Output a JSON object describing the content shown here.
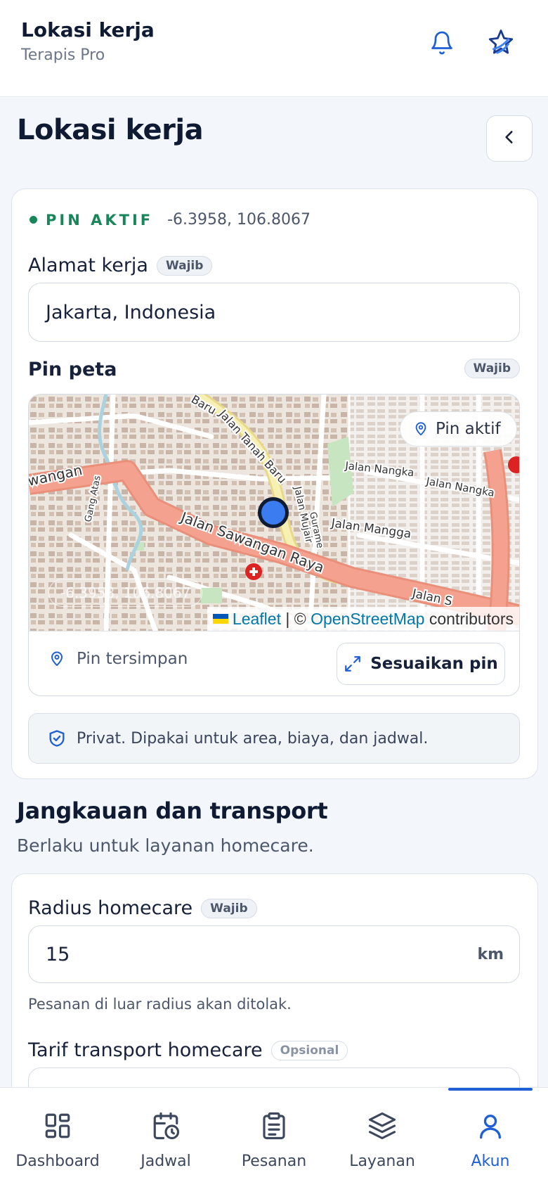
{
  "header": {
    "title": "Lokasi kerja",
    "subtitle": "Terapis Pro",
    "icons": {
      "notifications": "bell-icon",
      "brand": "brand-logo-icon"
    }
  },
  "page": {
    "title": "Lokasi kerja",
    "back_icon": "chevron-left-icon"
  },
  "location_card": {
    "status_label": "PIN AKTIF",
    "coords": "-6.3958, 106.8067",
    "address": {
      "label": "Alamat kerja",
      "badge": "Wajib",
      "value": "Jakarta, Indonesia"
    },
    "pin": {
      "label": "Pin peta",
      "badge": "Wajib",
      "map": {
        "chip": "Pin aktif",
        "coords_overlay": "-6.3958, 106.8067",
        "attribution": {
          "leaflet": "Leaflet",
          "separator": " | © ",
          "osm": "OpenStreetMap",
          "suffix": " contributors"
        },
        "streets": [
          "Jalan Sawangan Raya",
          "Jalan Mangga",
          "Jalan Nangka",
          "Jalan Nangka",
          "Jalan Mujair",
          "Gurame",
          "Jalan Tanah Baru",
          "Baru",
          "wangan",
          "Gang Atas",
          "Jalan S"
        ]
      },
      "saved_label": "Pin tersimpan",
      "adjust_button": "Sesuaikan pin"
    },
    "privacy_note": "Privat. Dipakai untuk area, biaya, dan jadwal."
  },
  "coverage": {
    "title": "Jangkauan dan transport",
    "subtitle": "Berlaku untuk layanan homecare.",
    "radius": {
      "label": "Radius homecare",
      "badge": "Wajib",
      "value": "15",
      "unit": "km",
      "helper": "Pesanan di luar radius akan ditolak."
    },
    "transport": {
      "label": "Tarif transport homecare",
      "badge": "Opsional"
    }
  },
  "nav": {
    "items": [
      {
        "label": "Dashboard",
        "icon": "grid-icon"
      },
      {
        "label": "Jadwal",
        "icon": "calendar-clock-icon"
      },
      {
        "label": "Pesanan",
        "icon": "clipboard-icon"
      },
      {
        "label": "Layanan",
        "icon": "layers-icon"
      },
      {
        "label": "Akun",
        "icon": "user-icon"
      }
    ],
    "active": "Akun"
  },
  "colors": {
    "accent": "#1f5fd6",
    "success": "#18865a",
    "text": "#0f1b33"
  }
}
